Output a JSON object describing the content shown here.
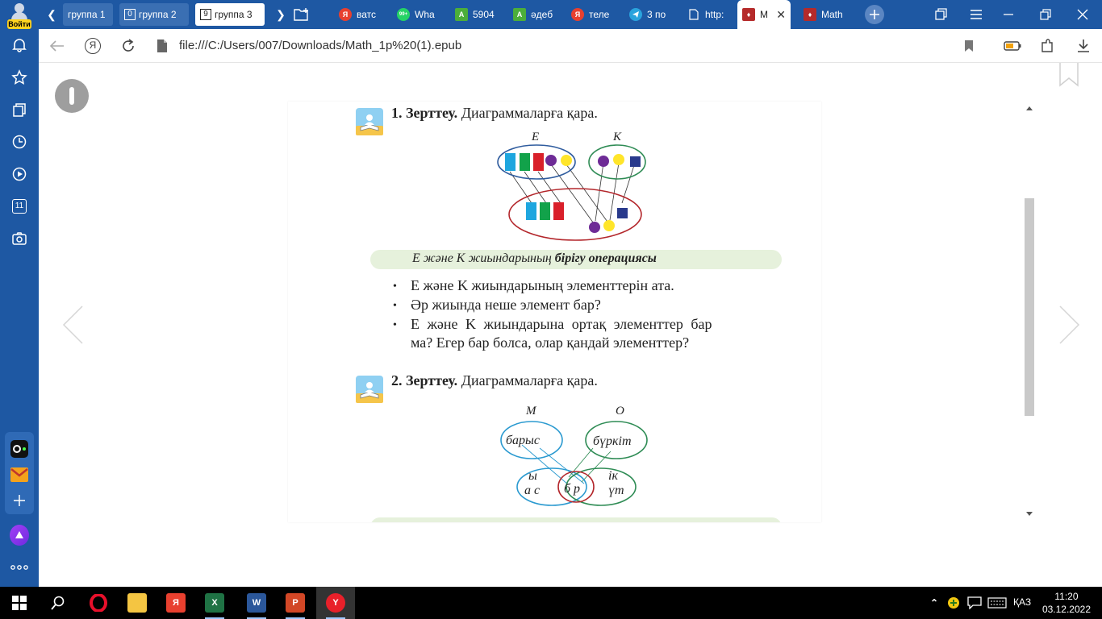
{
  "sidebar": {
    "login_label": "Войти",
    "counter_badge": "11",
    "icons": [
      "bell-icon",
      "star-icon",
      "collections-icon",
      "history-icon",
      "play-icon",
      "tabs-counter-icon",
      "screenshot-icon",
      "alice-icon",
      "mail-icon",
      "add-icon",
      "more-icon"
    ]
  },
  "tabbar": {
    "groups": [
      {
        "count": "",
        "label": "группа 1"
      },
      {
        "count": "0",
        "label": "группа 2"
      },
      {
        "count": "9",
        "label": "группа 3",
        "active": true
      }
    ],
    "tabs": [
      {
        "label": "ватс",
        "icon": "yandex-icon",
        "color": "#e8402f"
      },
      {
        "label": "Wha",
        "icon": "whatsapp-icon",
        "color": "#25d366",
        "badge": "99+"
      },
      {
        "label": "5904",
        "icon": "a-icon",
        "color": "#4cae3a"
      },
      {
        "label": "әдеб",
        "icon": "a-icon",
        "color": "#4cae3a"
      },
      {
        "label": "теле",
        "icon": "yandex-icon",
        "color": "#e8402f"
      },
      {
        "label": "3 по",
        "icon": "telegram-icon",
        "color": "#2aa3dd"
      },
      {
        "label": "http:",
        "icon": "file-icon",
        "color": "#ffffff"
      },
      {
        "label": "M",
        "icon": "book-icon",
        "color": "#b52a2a",
        "active": true
      },
      {
        "label": "Math",
        "icon": "book-icon",
        "color": "#b52a2a"
      }
    ]
  },
  "addressbar": {
    "url": "file:///C:/Users/007/Downloads/Math_1p%20(1).epub"
  },
  "book": {
    "task1": {
      "number": "1.",
      "title_bold": "Зерттеу.",
      "title_rest": "Диаграммаларға қара.",
      "set_e": "E",
      "set_k": "K",
      "caption_part1": "E және K жиындарының",
      "caption_part2": "бірігу операциясы",
      "bullets": [
        "E және K жиындарының элементтерін ата.",
        "Әр жиында неше элемент бар?",
        "E және K жиындарына ортақ элементтер бар",
        "ма? Егер бар болса, олар қандай элементтер?"
      ]
    },
    "task2": {
      "number": "2.",
      "title_bold": "Зерттеу.",
      "title_rest": "Диаграммаларға қара.",
      "set_m": "M",
      "set_o": "O",
      "word_m": "барыс",
      "word_o": "бүркіт",
      "letters_left_top": "ы",
      "letters_left_bottom": "а с",
      "letters_mid": "б р",
      "letters_right_top": "ік",
      "letters_right_bottom": "үт"
    }
  },
  "taskbar": {
    "lang": "ҚАЗ",
    "time": "11:20",
    "date": "03.12.2022"
  }
}
